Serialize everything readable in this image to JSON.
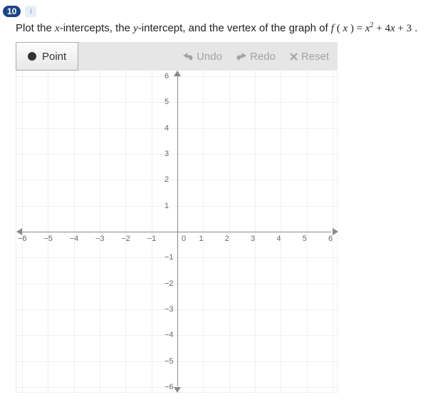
{
  "header": {
    "question_number": "10",
    "info_icon": "i"
  },
  "prompt": {
    "lead": "Plot the ",
    "x_var": "x",
    "seg1": "-intercepts, the ",
    "y_var": "y",
    "seg2": "-intercept, and the vertex of the graph of ",
    "fn_f": "f",
    "fn_open": " ( ",
    "fn_arg": "x",
    "fn_close": " ) ",
    "eq": "=",
    "term1_base": " x",
    "term1_exp": "2",
    "plus1": " + ",
    "term2_coef": "4",
    "term2_var": "x",
    "plus2": " + ",
    "term3": "3",
    "period": " ."
  },
  "toolbar": {
    "point_label": "Point",
    "undo": "Undo",
    "redo": "Redo",
    "reset": "Reset"
  },
  "chart_data": {
    "type": "scatter",
    "title": "",
    "xlabel": "",
    "ylabel": "",
    "xlim": [
      -6,
      6
    ],
    "ylim": [
      -6,
      6
    ],
    "x_ticks": [
      -6,
      -5,
      -4,
      -3,
      -2,
      -1,
      0,
      1,
      2,
      3,
      4,
      5,
      6
    ],
    "y_ticks": [
      -6,
      -5,
      -4,
      -3,
      -2,
      -1,
      0,
      1,
      2,
      3,
      4,
      5,
      6
    ],
    "series": [
      {
        "name": "plotted-points",
        "values": []
      }
    ]
  }
}
